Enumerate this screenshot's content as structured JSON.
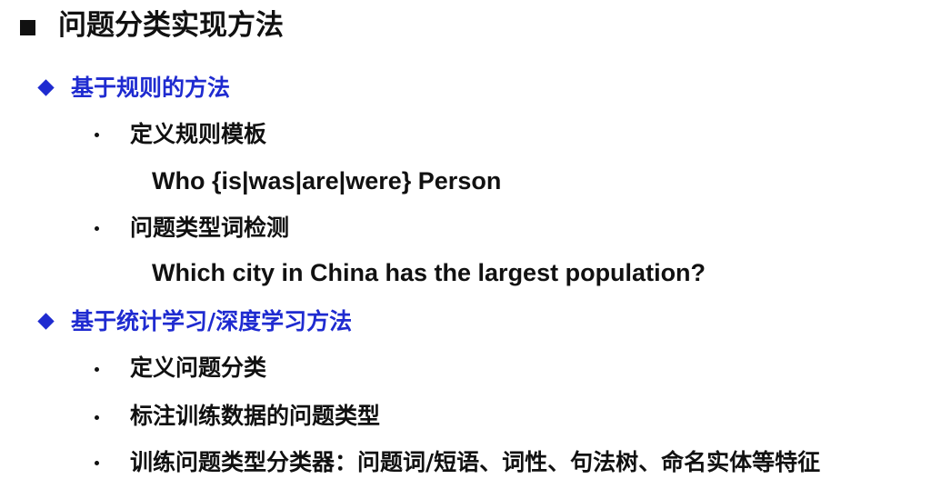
{
  "title": "问题分类实现方法",
  "sections": [
    {
      "heading": "基于规则的方法",
      "items": [
        {
          "text": "定义规则模板",
          "example": "Who {is|was|are|were} Person"
        },
        {
          "text": "问题类型词检测",
          "example": "Which city in China has the largest population?"
        }
      ]
    },
    {
      "heading": "基于统计学习/深度学习方法",
      "items": [
        {
          "text": "定义问题分类"
        },
        {
          "text": "标注训练数据的问题类型"
        },
        {
          "text": "训练问题类型分类器：问题词/短语、词性、句法树、命名实体等特征"
        }
      ]
    }
  ],
  "colors": {
    "heading_text": "#111111",
    "section_accent": "#1f2bd0",
    "body_text": "#111111"
  },
  "icons": {
    "title_marker": "square-bullet-icon",
    "section_marker": "diamond-bullet-icon",
    "item_marker": "dot-bullet-icon"
  }
}
